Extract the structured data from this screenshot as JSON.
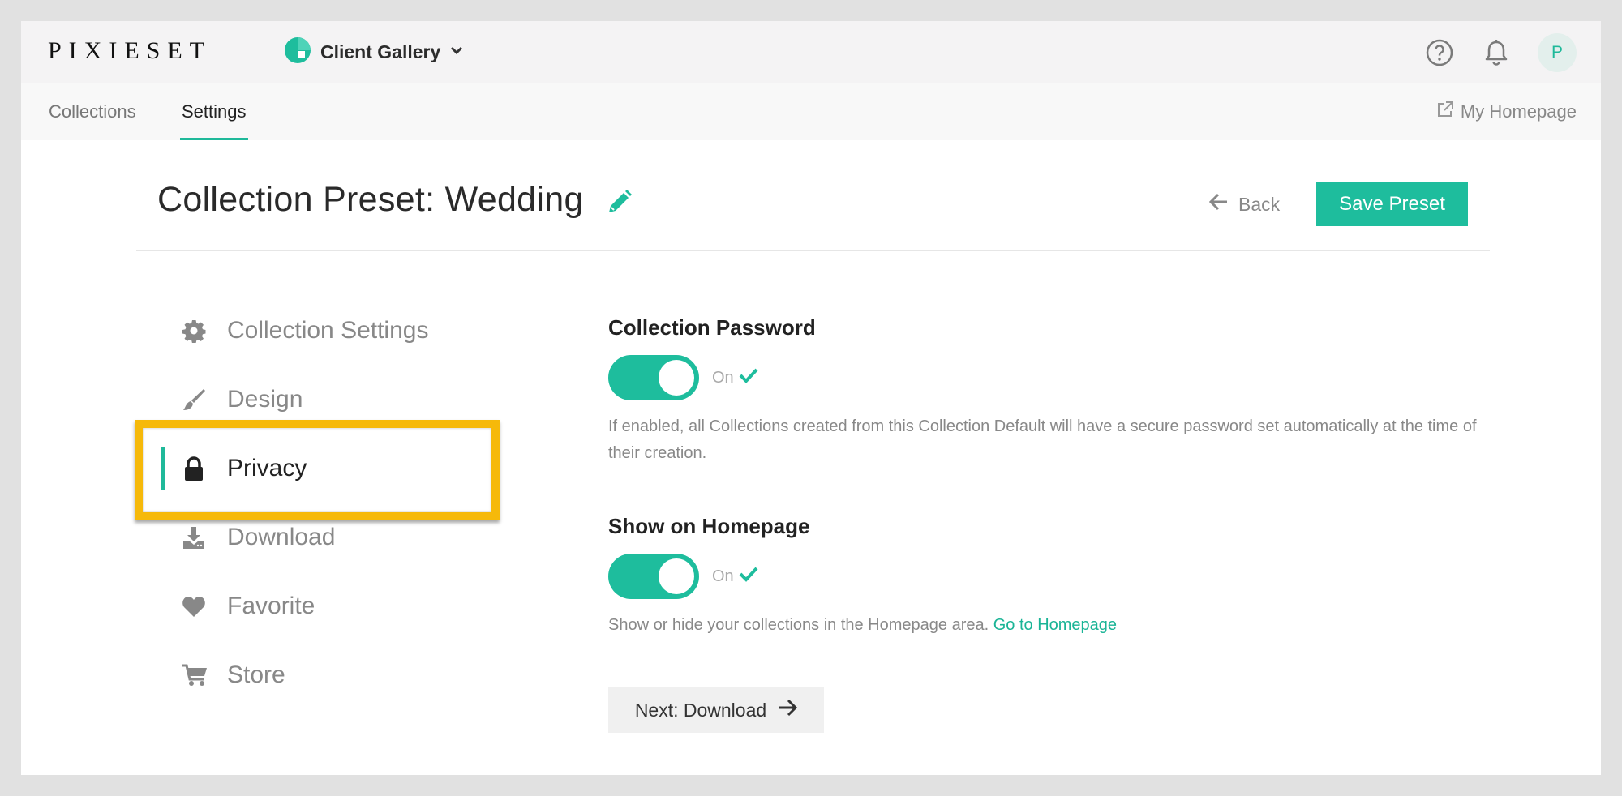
{
  "header": {
    "logo": "PIXIESET",
    "app_name": "Client Gallery"
  },
  "avatar_initial": "P",
  "subnav": {
    "tabs": [
      {
        "label": "Collections",
        "active": false
      },
      {
        "label": "Settings",
        "active": true
      }
    ],
    "homepage_link": "My Homepage"
  },
  "page": {
    "title": "Collection Preset: Wedding",
    "back_label": "Back",
    "save_label": "Save Preset"
  },
  "menu": {
    "items": [
      {
        "label": "Collection Settings",
        "icon": "gear-icon"
      },
      {
        "label": "Design",
        "icon": "brush-icon"
      },
      {
        "label": "Privacy",
        "icon": "lock-icon",
        "active": true
      },
      {
        "label": "Download",
        "icon": "download-icon"
      },
      {
        "label": "Favorite",
        "icon": "heart-icon"
      },
      {
        "label": "Store",
        "icon": "cart-icon"
      }
    ]
  },
  "settings": {
    "password": {
      "title": "Collection Password",
      "state": "On",
      "description": "If enabled, all Collections created from this Collection Default will have a secure password set automatically at the time of their creation."
    },
    "homepage": {
      "title": "Show on Homepage",
      "state": "On",
      "description": "Show or hide your collections in the Homepage area.",
      "link": "Go to Homepage"
    }
  },
  "next_button": "Next: Download",
  "colors": {
    "accent": "#1ebd9d",
    "highlight": "#f6b90a"
  }
}
